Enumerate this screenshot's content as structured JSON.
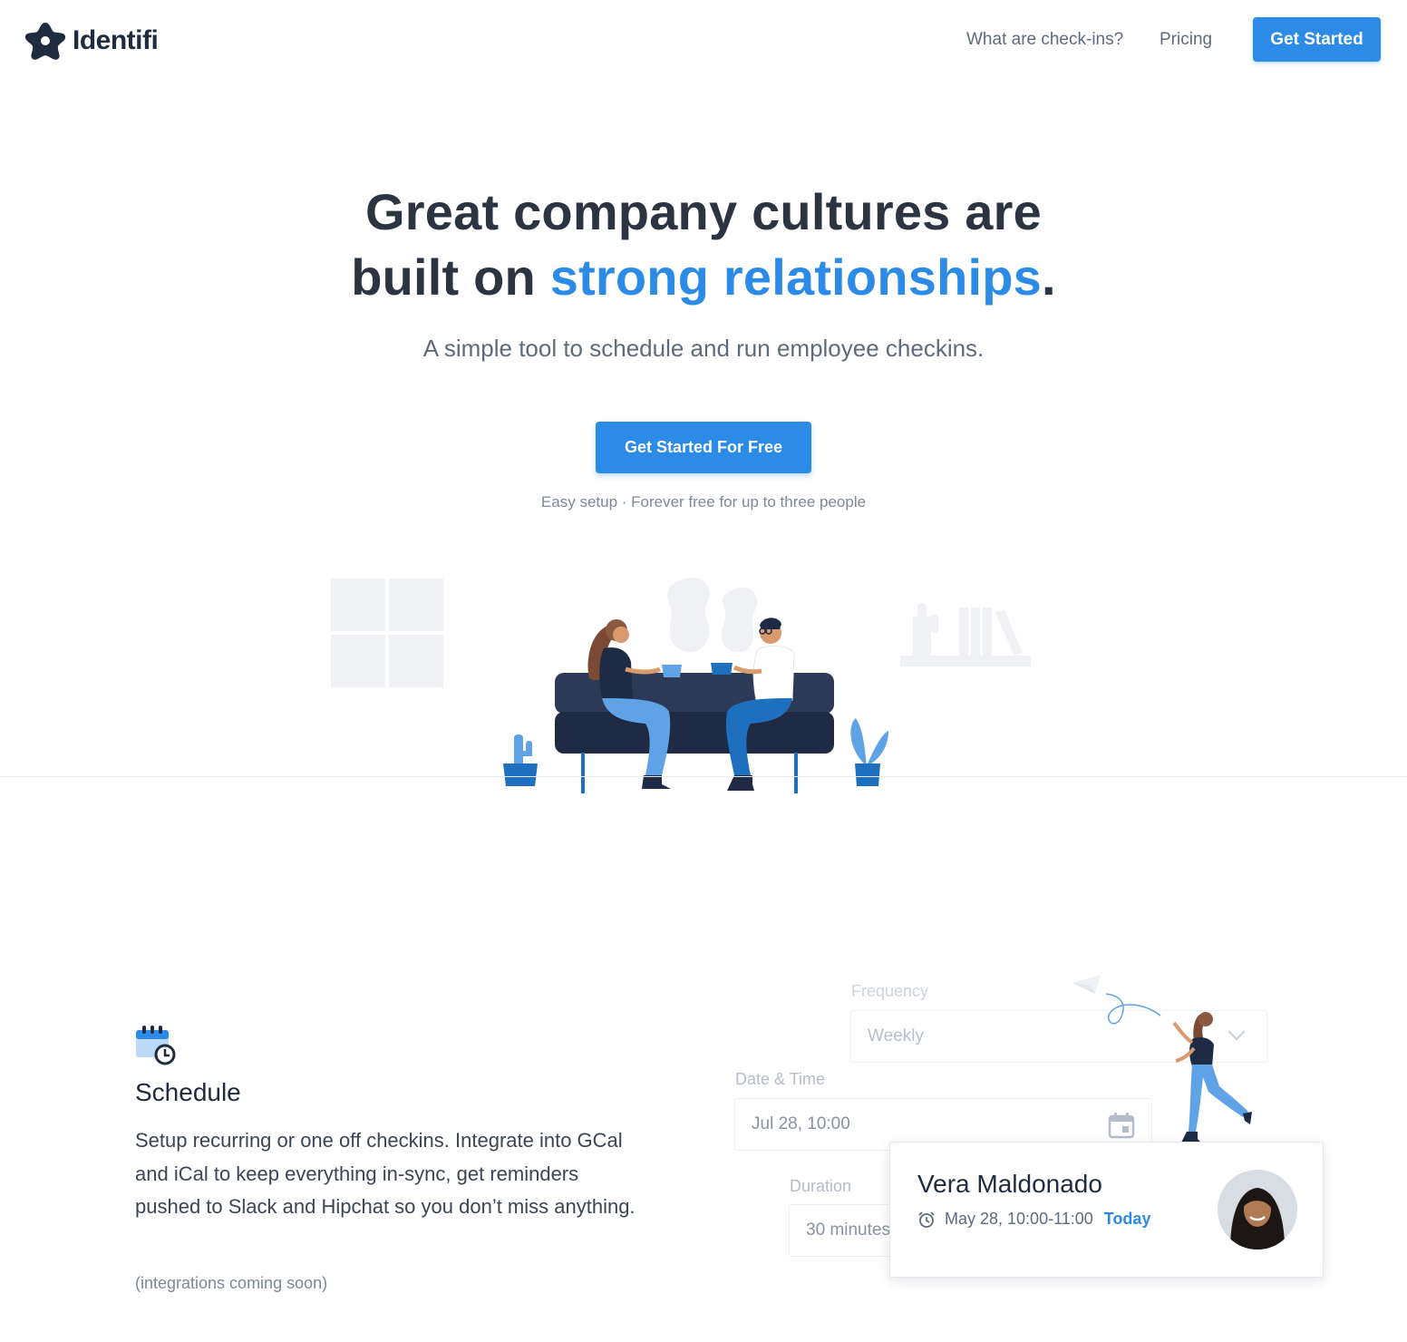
{
  "header": {
    "brand": "Identifi",
    "nav": {
      "checkins": "What are check-ins?",
      "pricing": "Pricing"
    },
    "cta": "Get Started"
  },
  "hero": {
    "title_line1": "Great company cultures are",
    "title_line2_prefix": "built on ",
    "title_line2_accent": "strong relationships",
    "title_line2_suffix": ".",
    "subtitle": "A simple tool to schedule and run employee checkins.",
    "cta": "Get Started For Free",
    "note": "Easy setup · Forever free for up to three people"
  },
  "schedule": {
    "title": "Schedule",
    "description": "Setup recurring or one off checkins. Integrate into GCal and iCal to keep everything in-sync, get reminders pushed to Slack and Hipchat so you don’t miss anything.",
    "note": "(integrations coming soon)",
    "form": {
      "frequency_label": "Frequency",
      "frequency_value": "Weekly",
      "datetime_label": "Date & Time",
      "datetime_value": "Jul 28, 10:00",
      "duration_label": "Duration",
      "duration_value": "30 minutes"
    },
    "card": {
      "name": "Vera Maldonado",
      "time": "May 28, 10:00-11:00",
      "badge": "Today"
    }
  },
  "colors": {
    "accent": "#2b8be6",
    "text_dark": "#2b3440",
    "navy": "#2d3a57"
  },
  "icons": [
    "logo-star-icon",
    "calendar-clock-icon",
    "chevron-down-icon",
    "calendar-icon",
    "alarm-clock-icon",
    "paper-plane-icon"
  ]
}
